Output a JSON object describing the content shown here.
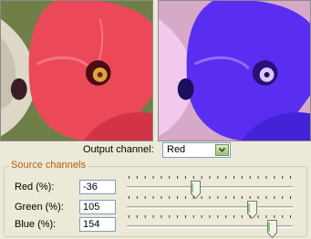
{
  "output": {
    "label": "Output channel:",
    "selected": "Red"
  },
  "source_group": {
    "title": "Source channels",
    "range": [
      -200,
      200
    ],
    "channels": [
      {
        "label": "Red (%):",
        "value": "-36",
        "level": -36
      },
      {
        "label": "Green (%):",
        "value": "105",
        "level": 105
      },
      {
        "label": "Blue (%):",
        "value": "154",
        "level": 154
      }
    ]
  },
  "colors": {
    "group_title": "#b05f10",
    "original_petal": "#ec4958",
    "result_petal": "#5a2ef0",
    "slider_thumb_fill": "#f3f2ea",
    "dropdown_arrow": "#6f9a4c"
  }
}
